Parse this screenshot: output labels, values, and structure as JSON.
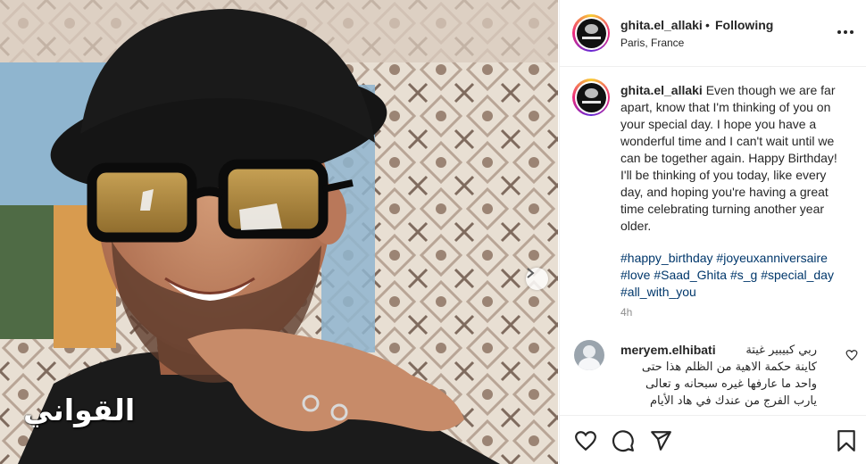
{
  "post": {
    "username": "ghita.el_allaki",
    "follow_status": "Following",
    "separator": "•",
    "location": "Paris, France",
    "caption": "Even though we are far apart, know that I'm thinking of you on your special day. I hope you have a wonderful time and I can't wait until we can be together again. Happy Birthday! I'll be thinking of you today, like every day, and hoping you're having a great time celebrating turning another year older.",
    "hashtags": [
      "#happy_birthday",
      "#joyeuxanniversaire",
      "#love",
      "#Saad_Ghita",
      "#s_g",
      "#special_day",
      "#all_with_you"
    ],
    "timestamp": "4h"
  },
  "comment": {
    "username": "meryem.elhibati",
    "text": "ربي كبيبير غيتة\nكاينة حكمة الاهية من الظلم هذا حتى\nواحد ما عارفها غيره سبحانه و تعالى\nيارب الفرج من عندك في هاد الأيام"
  },
  "media": {
    "watermark": "القواني"
  },
  "icons": {
    "more": "more-options-icon",
    "next": "chevron-right-icon",
    "like": "heart-icon",
    "comment": "comment-icon",
    "share": "send-icon",
    "save": "bookmark-icon",
    "comment_like": "small-heart-icon"
  },
  "colors": {
    "hashtag": "#00376b",
    "timestamp": "#8e8e8e",
    "text": "#262626",
    "border": "#efefef"
  }
}
